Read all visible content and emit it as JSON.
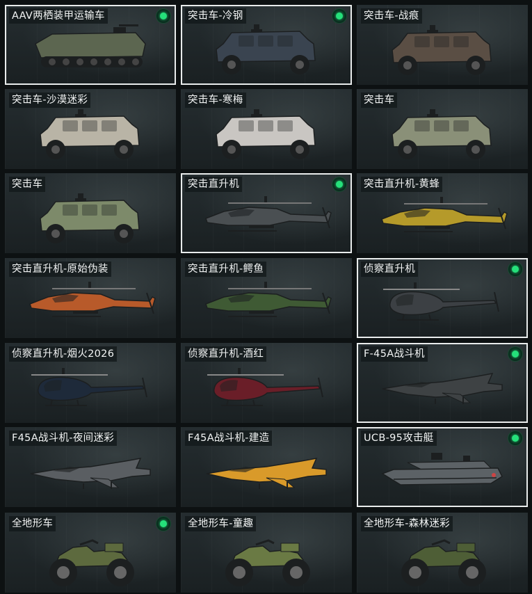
{
  "accent_color": "#25e07a",
  "selected_border_color": "#e9ecec",
  "vehicles": [
    {
      "name": "AAV两栖装甲运输车",
      "owned": true,
      "selected": true,
      "icon": "amphibious-vehicle-icon",
      "color": "#5c6650"
    },
    {
      "name": "突击车-冷钢",
      "owned": true,
      "selected": true,
      "icon": "assault-vehicle-icon",
      "color": "#3a4450"
    },
    {
      "name": "突击车-战痕",
      "owned": false,
      "selected": false,
      "icon": "assault-vehicle-icon",
      "color": "#5a4e44"
    },
    {
      "name": "突击车-沙漠迷彩",
      "owned": false,
      "selected": false,
      "icon": "assault-vehicle-icon",
      "color": "#b9b4a6"
    },
    {
      "name": "突击车-寒梅",
      "owned": false,
      "selected": false,
      "icon": "assault-vehicle-icon",
      "color": "#c9c6c2"
    },
    {
      "name": "突击车",
      "owned": false,
      "selected": false,
      "icon": "assault-vehicle-icon",
      "color": "#8a9078"
    },
    {
      "name": "突击车",
      "owned": false,
      "selected": false,
      "icon": "assault-vehicle-icon",
      "color": "#7d8a6a"
    },
    {
      "name": "突击直升机",
      "owned": true,
      "selected": true,
      "icon": "attack-helicopter-icon",
      "color": "#4a4f52"
    },
    {
      "name": "突击直升机-黄蜂",
      "owned": false,
      "selected": false,
      "icon": "attack-helicopter-icon",
      "color": "#b59a2a"
    },
    {
      "name": "突击直升机-原始伪装",
      "owned": false,
      "selected": false,
      "icon": "attack-helicopter-icon",
      "color": "#b85a2a"
    },
    {
      "name": "突击直升机-鳄鱼",
      "owned": false,
      "selected": false,
      "icon": "attack-helicopter-icon",
      "color": "#3f5a34"
    },
    {
      "name": "侦察直升机",
      "owned": true,
      "selected": true,
      "icon": "scout-helicopter-icon",
      "color": "#3c4044"
    },
    {
      "name": "侦察直升机-烟火2026",
      "owned": false,
      "selected": false,
      "icon": "scout-helicopter-icon",
      "color": "#1e2a3a"
    },
    {
      "name": "侦察直升机-酒红",
      "owned": false,
      "selected": false,
      "icon": "scout-helicopter-icon",
      "color": "#6a1e28"
    },
    {
      "name": "F-45A战斗机",
      "owned": true,
      "selected": true,
      "icon": "fighter-jet-icon",
      "color": "#3e4244"
    },
    {
      "name": "F45A战斗机-夜间迷彩",
      "owned": false,
      "selected": false,
      "icon": "fighter-jet-icon",
      "color": "#5a5e62"
    },
    {
      "name": "F45A战斗机-建造",
      "owned": false,
      "selected": false,
      "icon": "fighter-jet-icon",
      "color": "#d99a2a"
    },
    {
      "name": "UCB-95攻击艇",
      "owned": true,
      "selected": true,
      "icon": "attack-boat-icon",
      "color": "#5c6266"
    },
    {
      "name": "全地形车",
      "owned": true,
      "selected": false,
      "icon": "atv-icon",
      "color": "#5d6a3e"
    },
    {
      "name": "全地形车-童趣",
      "owned": false,
      "selected": false,
      "icon": "atv-icon",
      "color": "#6a7a44"
    },
    {
      "name": "全地形车-森林迷彩",
      "owned": false,
      "selected": false,
      "icon": "atv-icon",
      "color": "#4e5e36"
    }
  ]
}
